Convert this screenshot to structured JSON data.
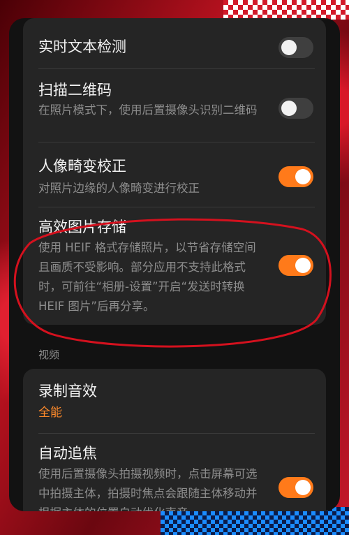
{
  "settings": {
    "live_text": {
      "title": "实时文本检测",
      "enabled": false
    },
    "qr_scan": {
      "title": "扫描二维码",
      "desc": "在照片模式下，使用后置摄像头识别二维码",
      "enabled": false
    },
    "portrait_correction": {
      "title": "人像畸变校正",
      "desc": "对照片边缘的人像畸变进行校正",
      "enabled": true
    },
    "heif": {
      "title": "高效图片存储",
      "desc": "使用 HEIF 格式存储照片，以节省存储空间且画质不受影响。部分应用不支持此格式时，可前往“相册-设置”开启“发送时转换 HEIF 图片”后再分享。",
      "enabled": true
    }
  },
  "video_section": {
    "label": "视频",
    "audio": {
      "title": "录制音效",
      "value": "全能"
    },
    "auto_track": {
      "title": "自动追焦",
      "desc": "使用后置摄像头拍摄视频时，点击屏幕可选中拍摄主体，拍摄时焦点会跟随主体移动并根据主体的位置自动优化声音",
      "enabled": true
    }
  },
  "colors": {
    "accent": "#ff7a1a",
    "annotation": "#d4111e",
    "card": "#252525",
    "background": "#121212"
  }
}
